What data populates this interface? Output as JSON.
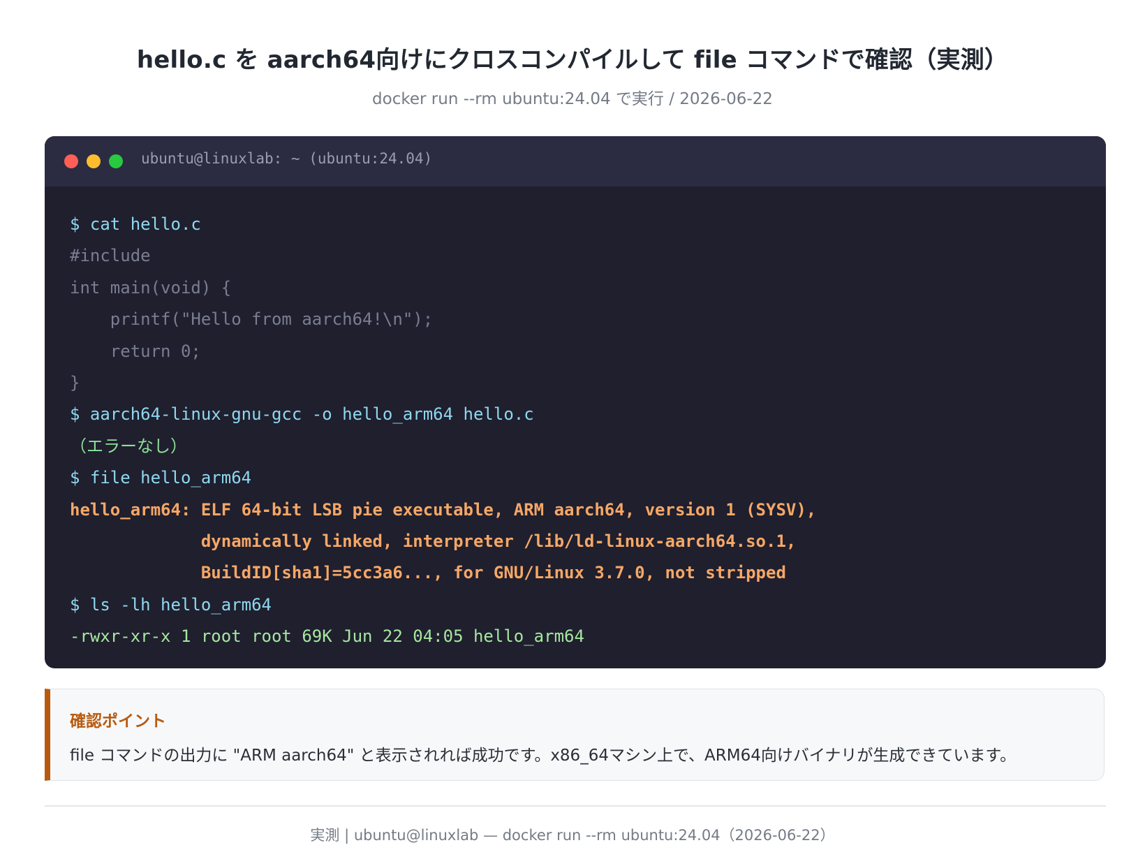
{
  "header": {
    "title": "hello.c を aarch64向けにクロスコンパイルして file コマンドで確認（実測）",
    "subtitle": "docker run --rm ubuntu:24.04 で実行 / 2026-06-22"
  },
  "terminal": {
    "window_title": "ubuntu@linuxlab: ~ (ubuntu:24.04)",
    "lines": [
      {
        "kind": "cmd",
        "text": "$ cat hello.c"
      },
      {
        "kind": "code",
        "text": "#include"
      },
      {
        "kind": "code",
        "text": "int main(void) {"
      },
      {
        "kind": "code",
        "text": "    printf(\"Hello from aarch64!\\n\");"
      },
      {
        "kind": "code",
        "text": "    return 0;"
      },
      {
        "kind": "code",
        "text": "}"
      },
      {
        "kind": "cmd",
        "text": "$ aarch64-linux-gnu-gcc -o hello_arm64 hello.c"
      },
      {
        "kind": "note",
        "text": "（エラーなし）"
      },
      {
        "kind": "cmd",
        "text": "$ file hello_arm64"
      },
      {
        "kind": "out",
        "text": "hello_arm64: ELF 64-bit LSB pie executable, ARM aarch64, version 1 (SYSV),"
      },
      {
        "kind": "out",
        "text": "             dynamically linked, interpreter /lib/ld-linux-aarch64.so.1,"
      },
      {
        "kind": "out",
        "text": "             BuildID[sha1]=5cc3a6..., for GNU/Linux 3.7.0, not stripped"
      },
      {
        "kind": "cmd",
        "text": "$ ls -lh hello_arm64"
      },
      {
        "kind": "ls",
        "text": "-rwxr-xr-x 1 root root 69K Jun 22 04:05 hello_arm64"
      }
    ]
  },
  "callout": {
    "title": "確認ポイント",
    "text": "file コマンドの出力に \"ARM aarch64\" と表示されれば成功です。x86_64マシン上で、ARM64向けバイナリが生成できています。"
  },
  "footer": {
    "text": "実測 | ubuntu@linuxlab — docker run --rm ubuntu:24.04（2026-06-22）"
  },
  "colors": {
    "terminal_bg": "#1f1f2e",
    "terminal_bar": "#2b2c41",
    "command": "#8fd8ef",
    "code": "#7a7d92",
    "note": "#8fe09a",
    "output": "#f6a766",
    "listing": "#a7e7a0",
    "accent": "#b85a0e"
  }
}
